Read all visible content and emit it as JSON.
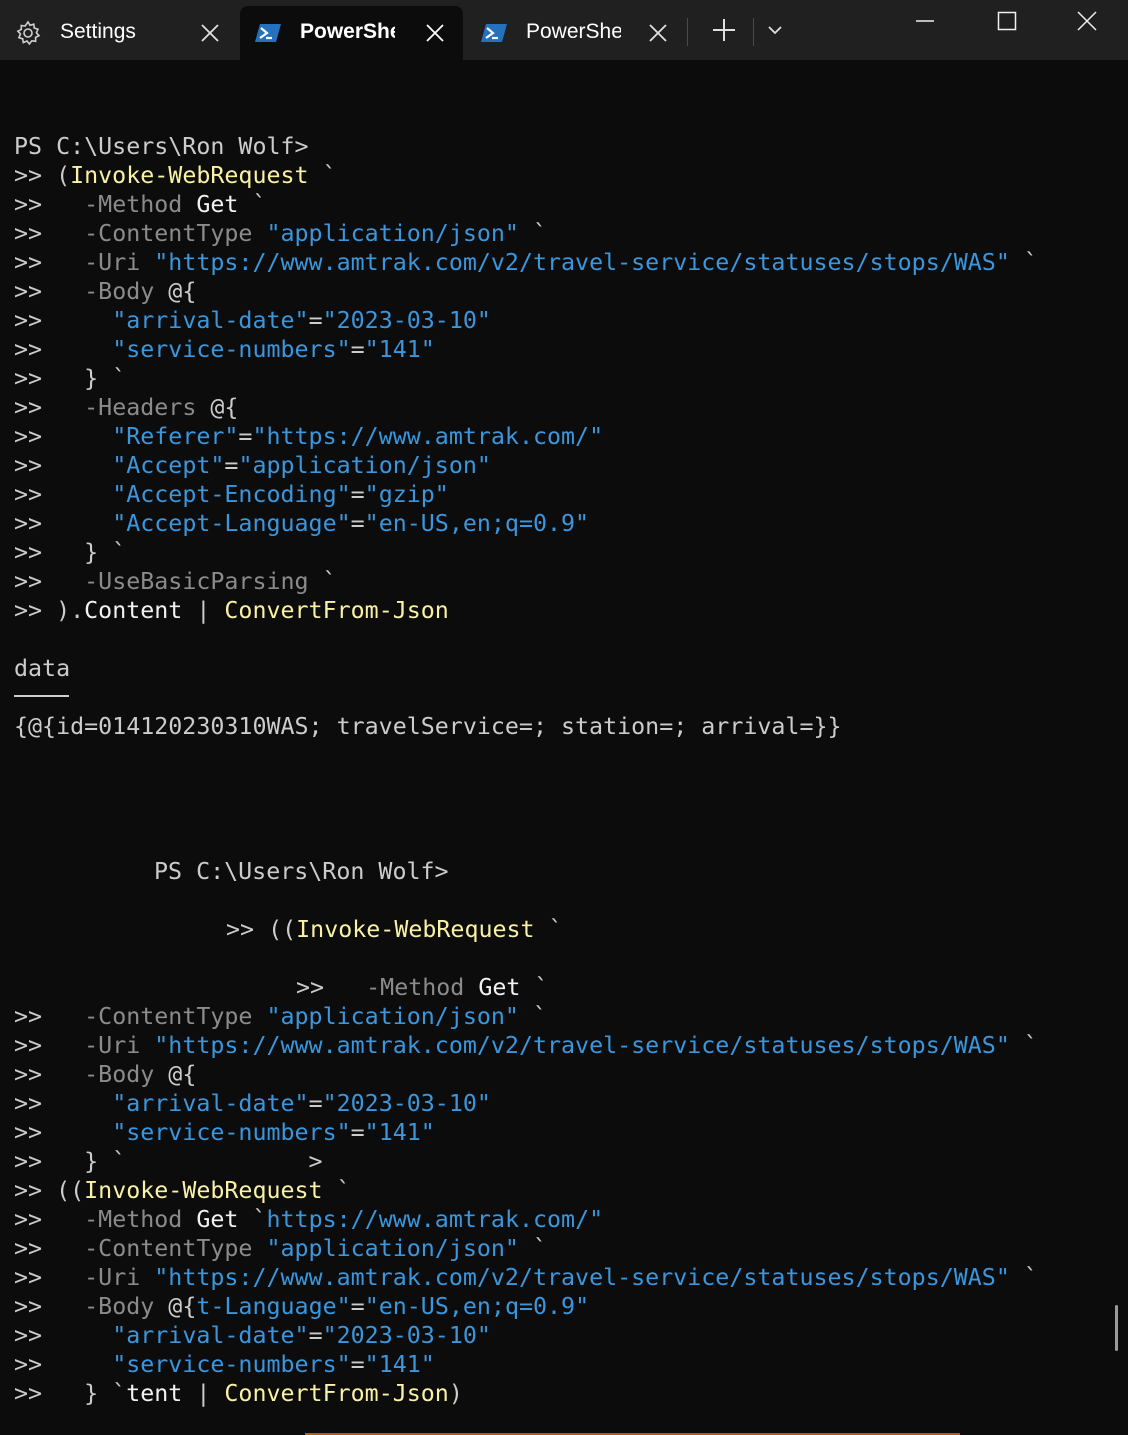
{
  "window": {
    "tabs": [
      {
        "label": "Settings",
        "icon": "gear-icon",
        "active": false
      },
      {
        "label": "PowerShe",
        "icon": "powershell-icon",
        "active": true
      },
      {
        "label": "PowerShe",
        "icon": "powershell-icon",
        "active": false
      }
    ],
    "colors": {
      "titlebar": "#202020",
      "terminal_bg": "#0c0c0c",
      "command": "#f9f1a5",
      "parameter": "#8b8b8b",
      "string": "#3a96dd",
      "text": "#cccccc",
      "powershell_icon": "#2671be"
    }
  },
  "terminal": {
    "lines": [
      {
        "segs": [
          [
            "t-default",
            "PS C:\\Users\\Ron Wolf>"
          ]
        ]
      },
      {
        "segs": [
          [
            "t-default",
            ">> ("
          ],
          [
            "t-cmd",
            "Invoke-WebRequest"
          ],
          [
            "t-default",
            " `"
          ]
        ]
      },
      {
        "segs": [
          [
            "t-default",
            ">>   "
          ],
          [
            "t-param",
            "-Method"
          ],
          [
            "t-bright",
            " Get"
          ],
          [
            "t-default",
            " `"
          ]
        ]
      },
      {
        "segs": [
          [
            "t-default",
            ">>   "
          ],
          [
            "t-param",
            "-ContentType"
          ],
          [
            "t-str",
            " \"application/json\""
          ],
          [
            "t-default",
            " `"
          ]
        ]
      },
      {
        "segs": [
          [
            "t-default",
            ">>   "
          ],
          [
            "t-param",
            "-Uri"
          ],
          [
            "t-str",
            " \"https://www.amtrak.com/v2/travel-service/statuses/stops/WAS\""
          ],
          [
            "t-default",
            " `"
          ]
        ]
      },
      {
        "segs": [
          [
            "t-default",
            ">>   "
          ],
          [
            "t-param",
            "-Body"
          ],
          [
            "t-default",
            " @{"
          ]
        ]
      },
      {
        "segs": [
          [
            "t-default",
            ">>     "
          ],
          [
            "t-str",
            "\"arrival-date\""
          ],
          [
            "t-default",
            "="
          ],
          [
            "t-str",
            "\"2023-03-10\""
          ]
        ]
      },
      {
        "segs": [
          [
            "t-default",
            ">>     "
          ],
          [
            "t-str",
            "\"service-numbers\""
          ],
          [
            "t-default",
            "="
          ],
          [
            "t-str",
            "\"141\""
          ]
        ]
      },
      {
        "segs": [
          [
            "t-default",
            ">>   } `"
          ]
        ]
      },
      {
        "segs": [
          [
            "t-default",
            ">>   "
          ],
          [
            "t-param",
            "-Headers"
          ],
          [
            "t-default",
            " @{"
          ]
        ]
      },
      {
        "segs": [
          [
            "t-default",
            ">>     "
          ],
          [
            "t-str",
            "\"Referer\""
          ],
          [
            "t-default",
            "="
          ],
          [
            "t-str",
            "\"https://www.amtrak.com/\""
          ]
        ]
      },
      {
        "segs": [
          [
            "t-default",
            ">>     "
          ],
          [
            "t-str",
            "\"Accept\""
          ],
          [
            "t-default",
            "="
          ],
          [
            "t-str",
            "\"application/json\""
          ]
        ]
      },
      {
        "segs": [
          [
            "t-default",
            ">>     "
          ],
          [
            "t-str",
            "\"Accept-Encoding\""
          ],
          [
            "t-default",
            "="
          ],
          [
            "t-str",
            "\"gzip\""
          ]
        ]
      },
      {
        "segs": [
          [
            "t-default",
            ">>     "
          ],
          [
            "t-str",
            "\"Accept-Language\""
          ],
          [
            "t-default",
            "="
          ],
          [
            "t-str",
            "\"en-US,en;q=0.9\""
          ]
        ]
      },
      {
        "segs": [
          [
            "t-default",
            ">>   } `"
          ]
        ]
      },
      {
        "segs": [
          [
            "t-default",
            ">>   "
          ],
          [
            "t-param",
            "-UseBasicParsing"
          ],
          [
            "t-default",
            " `"
          ]
        ]
      },
      {
        "segs": [
          [
            "t-default",
            ">> )."
          ],
          [
            "t-bright",
            "Content"
          ],
          [
            "t-default",
            " | "
          ],
          [
            "t-cmd",
            "ConvertFrom-Json"
          ]
        ]
      },
      {
        "segs": [
          [
            "t-default",
            "data"
          ]
        ]
      },
      {
        "segs": [
          [
            "t-default",
            "{@{id=014120230310WAS; travelService=; station=; arrival=}}"
          ]
        ]
      },
      {
        "segs": [
          [
            "t-default",
            "PS C:\\Users\\Ron Wolf>"
          ]
        ]
      },
      {
        "segs": [
          [
            "t-default",
            ">> (("
          ],
          [
            "t-cmd",
            "Invoke-WebRequest"
          ],
          [
            "t-default",
            " `"
          ]
        ]
      },
      {
        "segs": [
          [
            "t-default",
            ">>   "
          ],
          [
            "t-param",
            "-Method"
          ],
          [
            "t-bright",
            " Get"
          ],
          [
            "t-default",
            " `"
          ]
        ]
      },
      {
        "segs": [
          [
            "t-default",
            ">>   "
          ],
          [
            "t-param",
            "-ContentType"
          ],
          [
            "t-str",
            " \"application/json\""
          ],
          [
            "t-default",
            " `"
          ]
        ]
      },
      {
        "segs": [
          [
            "t-default",
            ">>   "
          ],
          [
            "t-param",
            "-Uri"
          ],
          [
            "t-str",
            " \"https://www.amtrak.com/v2/travel-service/statuses/stops/WAS\""
          ],
          [
            "t-default",
            " `"
          ]
        ]
      },
      {
        "segs": [
          [
            "t-default",
            ">>   "
          ],
          [
            "t-param",
            "-Body"
          ],
          [
            "t-default",
            " @{"
          ]
        ]
      },
      {
        "segs": [
          [
            "t-default",
            ">>     "
          ],
          [
            "t-str",
            "\"arrival-date\""
          ],
          [
            "t-default",
            "="
          ],
          [
            "t-str",
            "\"2023-03-10\""
          ]
        ]
      },
      {
        "segs": [
          [
            "t-default",
            ">>     "
          ],
          [
            "t-str",
            "\"service-numbers\""
          ],
          [
            "t-default",
            "="
          ],
          [
            "t-str",
            "\"141\""
          ]
        ]
      },
      {
        "segs": [
          [
            "t-default",
            ">>   } `             >"
          ]
        ]
      },
      {
        "segs": [
          [
            "t-default",
            ">> (("
          ],
          [
            "t-cmd",
            "Invoke-WebRequest"
          ],
          [
            "t-default",
            " `"
          ]
        ]
      },
      {
        "segs": [
          [
            "t-default",
            ">>   "
          ],
          [
            "t-param",
            "-Method"
          ],
          [
            "t-bright",
            " Get"
          ],
          [
            "t-default",
            " `"
          ],
          [
            "t-str",
            "https://www.amtrak.com/\""
          ]
        ]
      },
      {
        "segs": [
          [
            "t-default",
            ">>   "
          ],
          [
            "t-param",
            "-ContentType"
          ],
          [
            "t-str",
            " \"application/json\""
          ],
          [
            "t-default",
            " `"
          ]
        ]
      },
      {
        "segs": [
          [
            "t-default",
            ">>   "
          ],
          [
            "t-param",
            "-Uri"
          ],
          [
            "t-str",
            " \"https://www.amtrak.com/v2/travel-service/statuses/stops/WAS\""
          ],
          [
            "t-default",
            " `"
          ]
        ]
      },
      {
        "segs": [
          [
            "t-default",
            ">>   "
          ],
          [
            "t-param",
            "-Body"
          ],
          [
            "t-default",
            " @{"
          ],
          [
            "t-str",
            "t-Language\""
          ],
          [
            "t-default",
            "="
          ],
          [
            "t-str",
            "\"en-US,en;q=0.9\""
          ]
        ]
      },
      {
        "segs": [
          [
            "t-default",
            ">>     "
          ],
          [
            "t-str",
            "\"arrival-date\""
          ],
          [
            "t-default",
            "="
          ],
          [
            "t-str",
            "\"2023-03-10\""
          ]
        ]
      },
      {
        "segs": [
          [
            "t-default",
            ">>     "
          ],
          [
            "t-str",
            "\"service-numbers\""
          ],
          [
            "t-default",
            "="
          ],
          [
            "t-str",
            "\"141\""
          ]
        ]
      },
      {
        "segs": [
          [
            "t-default",
            ">>   } `"
          ],
          [
            "t-bright",
            "tent"
          ],
          [
            "t-default",
            " | "
          ],
          [
            "t-cmd",
            "ConvertFrom-Json"
          ],
          [
            "t-default",
            ")"
          ]
        ]
      }
    ]
  }
}
